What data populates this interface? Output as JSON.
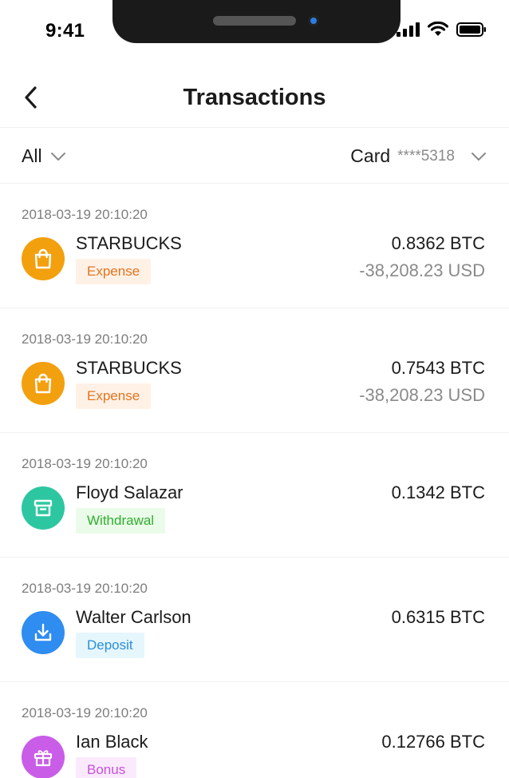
{
  "status_bar": {
    "time": "9:41"
  },
  "header": {
    "title": "Transactions",
    "back_icon": "chevron-left-icon"
  },
  "filters": {
    "type": {
      "label": "All",
      "icon": "chevron-down-icon"
    },
    "card": {
      "label": "Card",
      "masked_number": "****5318",
      "icon": "chevron-down-icon"
    }
  },
  "transactions": [
    {
      "date": "2018-03-19 20:10:20",
      "name": "STARBUCKS",
      "tag": "Expense",
      "btc": "0.8362 BTC",
      "usd": "-38,208.23 USD",
      "icon": "shopping-bag-icon",
      "icon_color": "#f3a00f",
      "tag_bg": "#fff1e6",
      "tag_color": "#e2741f"
    },
    {
      "date": "2018-03-19 20:10:20",
      "name": "STARBUCKS",
      "tag": "Expense",
      "btc": "0.7543 BTC",
      "usd": "-38,208.23 USD",
      "icon": "shopping-bag-icon",
      "icon_color": "#f3a00f",
      "tag_bg": "#fff1e6",
      "tag_color": "#e2741f"
    },
    {
      "date": "2018-03-19 20:10:20",
      "name": "Floyd Salazar",
      "tag": "Withdrawal",
      "btc": "0.1342 BTC",
      "usd": "",
      "icon": "archive-box-icon",
      "icon_color": "#2cc7a0",
      "tag_bg": "#ebfbe9",
      "tag_color": "#2faf2f"
    },
    {
      "date": "2018-03-19 20:10:20",
      "name": "Walter Carlson",
      "tag": "Deposit",
      "btc": "0.6315 BTC",
      "usd": "",
      "icon": "download-icon",
      "icon_color": "#2f8cf0",
      "tag_bg": "#e6f6fd",
      "tag_color": "#2b8fd8"
    },
    {
      "date": "2018-03-19 20:10:20",
      "name": "Ian Black",
      "tag": "Bonus",
      "btc": "0.12766 BTC",
      "usd": "",
      "icon": "gift-icon",
      "icon_color": "#c95de8",
      "tag_bg": "#fbeafd",
      "tag_color": "#c652da"
    }
  ]
}
